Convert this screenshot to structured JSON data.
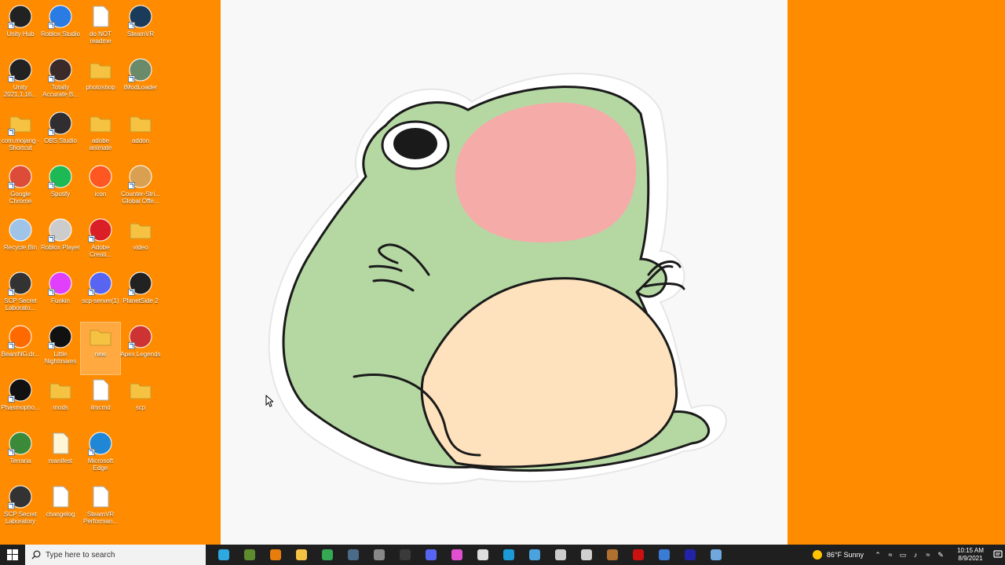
{
  "desktop": {
    "icons": [
      {
        "label": "Unity Hub",
        "icon": "unity-hub-icon",
        "shortcut": true
      },
      {
        "label": "Roblox Studio",
        "icon": "roblox-studio-icon",
        "shortcut": true
      },
      {
        "label": "do NOT readme",
        "icon": "text-file-icon",
        "shortcut": false
      },
      {
        "label": "SteamVR",
        "icon": "steamvr-icon",
        "shortcut": true
      },
      {
        "label": "Unity 2021.1.16...",
        "icon": "unity-icon",
        "shortcut": true
      },
      {
        "label": "Totally Accurate B...",
        "icon": "tabs-game-icon",
        "shortcut": true
      },
      {
        "label": "photoshop",
        "icon": "folder-icon",
        "shortcut": false
      },
      {
        "label": "tModLoader",
        "icon": "tmodloader-icon",
        "shortcut": true
      },
      {
        "label": "com.mojang - Shortcut",
        "icon": "folder-icon",
        "shortcut": true
      },
      {
        "label": "OBS Studio",
        "icon": "obs-icon",
        "shortcut": true
      },
      {
        "label": "adobe animate",
        "icon": "folder-icon",
        "shortcut": false
      },
      {
        "label": "addon",
        "icon": "folder-icon",
        "shortcut": false
      },
      {
        "label": "Google Chrome",
        "icon": "chrome-icon",
        "shortcut": true
      },
      {
        "label": "Spotify",
        "icon": "spotify-icon",
        "shortcut": true
      },
      {
        "label": "icon",
        "icon": "colorful-icon",
        "shortcut": false
      },
      {
        "label": "Counter-Stri... Global Offe...",
        "icon": "csgo-icon",
        "shortcut": true
      },
      {
        "label": "Recycle Bin",
        "icon": "recycle-bin-icon",
        "shortcut": false
      },
      {
        "label": "Roblox Player",
        "icon": "roblox-player-icon",
        "shortcut": true
      },
      {
        "label": "Adobe Creati...",
        "icon": "adobe-cc-icon",
        "shortcut": true
      },
      {
        "label": "video",
        "icon": "folder-icon",
        "shortcut": false
      },
      {
        "label": "SCP Secret Laborato...",
        "icon": "scp-icon",
        "shortcut": true
      },
      {
        "label": "Funkin",
        "icon": "funkin-icon",
        "shortcut": true
      },
      {
        "label": "scp-server(1)",
        "icon": "discord-icon",
        "shortcut": true
      },
      {
        "label": "PlanetSide 2",
        "icon": "planetside-icon",
        "shortcut": true
      },
      {
        "label": "BeamNG.dr...",
        "icon": "beamng-icon",
        "shortcut": true
      },
      {
        "label": "Little Nightmares",
        "icon": "little-nightmares-icon",
        "shortcut": true
      },
      {
        "label": "new",
        "icon": "folder-icon",
        "shortcut": false,
        "selected": true
      },
      {
        "label": "Apex Legends",
        "icon": "apex-icon",
        "shortcut": true
      },
      {
        "label": "Phasmopho...",
        "icon": "phasmophobia-icon",
        "shortcut": true
      },
      {
        "label": "mods",
        "icon": "folder-icon",
        "shortcut": false
      },
      {
        "label": "ilmcmd",
        "icon": "text-file-icon",
        "shortcut": false
      },
      {
        "label": "scp",
        "icon": "folder-icon",
        "shortcut": false
      },
      {
        "label": "Terraria",
        "icon": "terraria-icon",
        "shortcut": true
      },
      {
        "label": "manifest",
        "icon": "json-file-icon",
        "shortcut": false
      },
      {
        "label": "Microsoft Edge",
        "icon": "edge-icon",
        "shortcut": true
      },
      {
        "label": "",
        "icon": "",
        "shortcut": false
      },
      {
        "label": "SCP Secret Laboratory",
        "icon": "scp-icon",
        "shortcut": true
      },
      {
        "label": "changelog",
        "icon": "text-file-icon",
        "shortcut": false
      },
      {
        "label": "SteamVR Performan...",
        "icon": "text-file-icon",
        "shortcut": false
      }
    ]
  },
  "taskbar": {
    "search_placeholder": "Type here to search",
    "pinned": [
      {
        "name": "edge",
        "color": "#2ea8e0"
      },
      {
        "name": "minecraft",
        "color": "#5d8c2e"
      },
      {
        "name": "blender",
        "color": "#e87d0d"
      },
      {
        "name": "file-explorer",
        "color": "#f5c242"
      },
      {
        "name": "chrome",
        "color": "#34a853"
      },
      {
        "name": "steam",
        "color": "#4c6b8a"
      },
      {
        "name": "snipping-tool",
        "color": "#888888"
      },
      {
        "name": "obs",
        "color": "#3a3a3a"
      },
      {
        "name": "discord",
        "color": "#5865f2"
      },
      {
        "name": "paint",
        "color": "#e04fd0"
      },
      {
        "name": "notepad",
        "color": "#dddddd"
      },
      {
        "name": "steam-2",
        "color": "#1b9ad6"
      },
      {
        "name": "calculator",
        "color": "#4aa3df"
      },
      {
        "name": "sticky",
        "color": "#cccccc"
      },
      {
        "name": "roblox",
        "color": "#d0d0d0"
      },
      {
        "name": "mod-tool",
        "color": "#b07030"
      },
      {
        "name": "record",
        "color": "#cc1111"
      },
      {
        "name": "steam-3",
        "color": "#3a7bd5"
      },
      {
        "name": "ru",
        "color": "#2323a8"
      },
      {
        "name": "steam-4",
        "color": "#6fa8dc"
      }
    ],
    "weather": "86°F  Sunny",
    "time": "10:15 AM",
    "date": "8/9/2021"
  }
}
